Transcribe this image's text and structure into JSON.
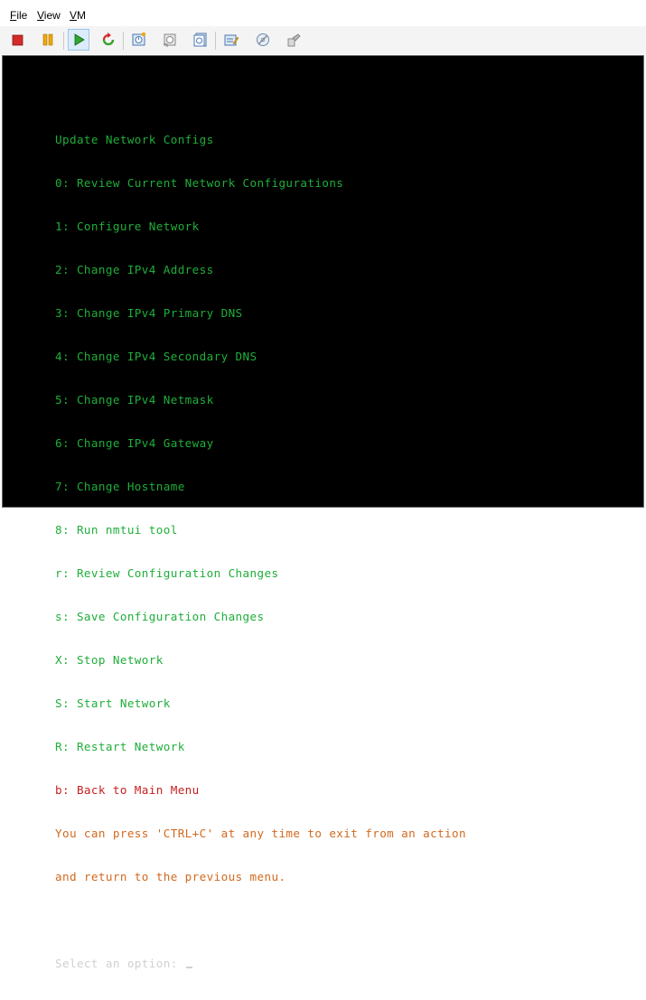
{
  "menu": {
    "file": {
      "u": "F",
      "rest": "ile"
    },
    "view": {
      "u": "V",
      "rest": "iew"
    },
    "vm": {
      "u": "V",
      "rest": "M"
    }
  },
  "toolbar": {
    "buttons": [
      "stop-icon",
      "pause-icon",
      "start-icon",
      "reset-icon",
      "snapshot-icon",
      "revert-icon",
      "snapshot-manager-icon",
      "settings-icon",
      "insert-disk-icon",
      "share-icon"
    ]
  },
  "colors": {
    "console_bg": "#000000",
    "menu_text": "#1fae3a",
    "back_text": "#c81e1e",
    "note_text": "#d2691e",
    "prompt_text": "#d0d0d0"
  },
  "console": {
    "title": "Update Network Configs",
    "options": [
      "0: Review Current Network Configurations",
      "1: Configure Network",
      "2: Change IPv4 Address",
      "3: Change IPv4 Primary DNS",
      "4: Change IPv4 Secondary DNS",
      "5: Change IPv4 Netmask",
      "6: Change IPv4 Gateway",
      "7: Change Hostname",
      "8: Run nmtui tool",
      "r: Review Configuration Changes",
      "s: Save Configuration Changes",
      "X: Stop Network",
      "S: Start Network",
      "R: Restart Network"
    ],
    "back_option": "b: Back to Main Menu",
    "note_line1": "You can press 'CTRL+C' at any time to exit from an action",
    "note_line2": "and return to the previous menu.",
    "prompt": "Select an option: "
  }
}
